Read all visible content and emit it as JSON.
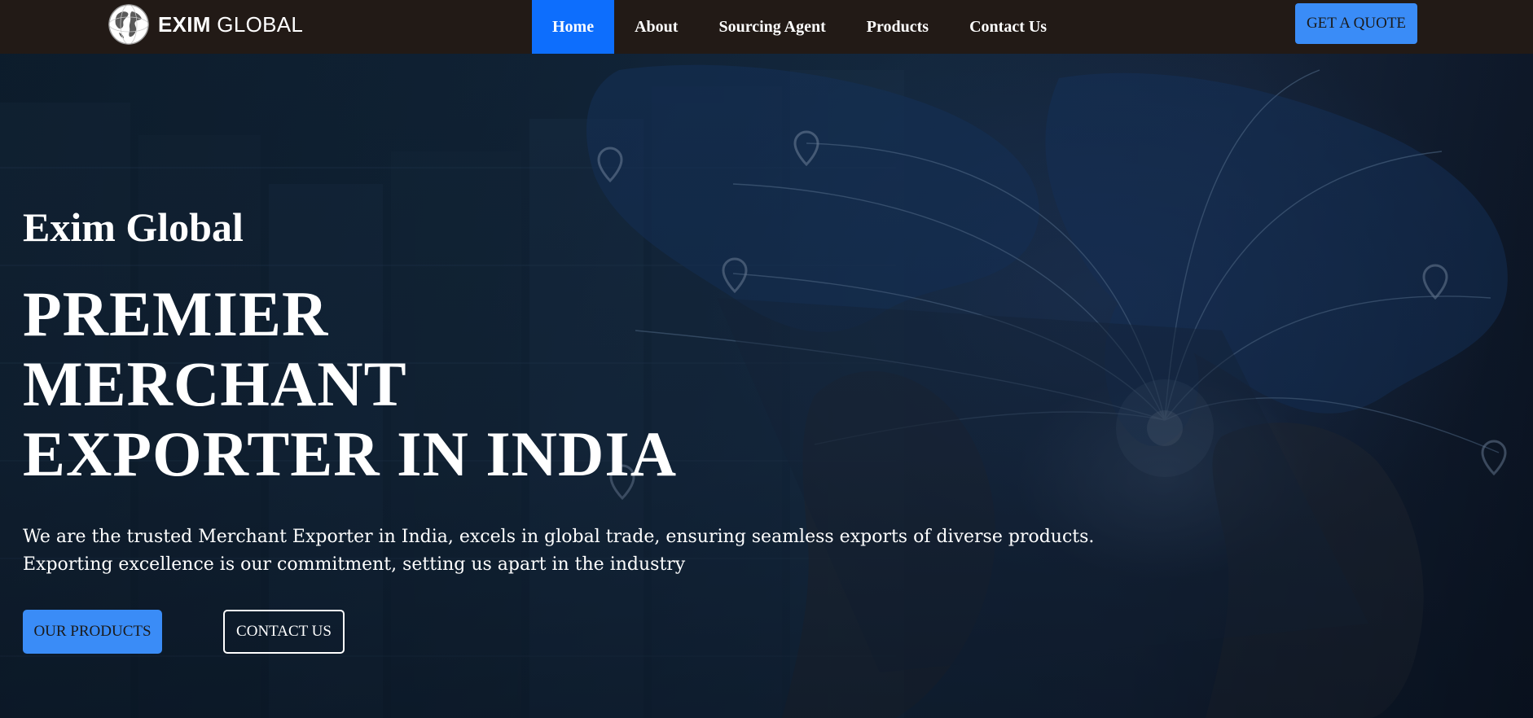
{
  "navbar": {
    "logo": {
      "bold": "EXIM",
      "light": "GLOBAL",
      "icon": "globe-icon"
    },
    "links": [
      {
        "label": "Home",
        "active": true
      },
      {
        "label": "About",
        "active": false
      },
      {
        "label": "Sourcing Agent",
        "active": false
      },
      {
        "label": "Products",
        "active": false
      },
      {
        "label": "Contact Us",
        "active": false
      }
    ],
    "quote_button": "GET A QUOTE"
  },
  "hero": {
    "brand": "Exim Global",
    "title_lines": [
      "PREMIER",
      "MERCHANT",
      "EXPORTER IN INDIA"
    ],
    "description_lines": [
      "We are the trusted Merchant Exporter in India, excels in global trade, ensuring seamless exports of diverse products.",
      "Exporting excellence is our commitment, setting us apart in the industry"
    ],
    "primary_button": "OUR PRODUCTS",
    "secondary_button": "CONTACT US"
  },
  "colors": {
    "navbar_bg": "#221a16",
    "active_nav": "#0d6efd",
    "button_blue": "#3a8cf7",
    "hero_text": "#ffffff"
  }
}
